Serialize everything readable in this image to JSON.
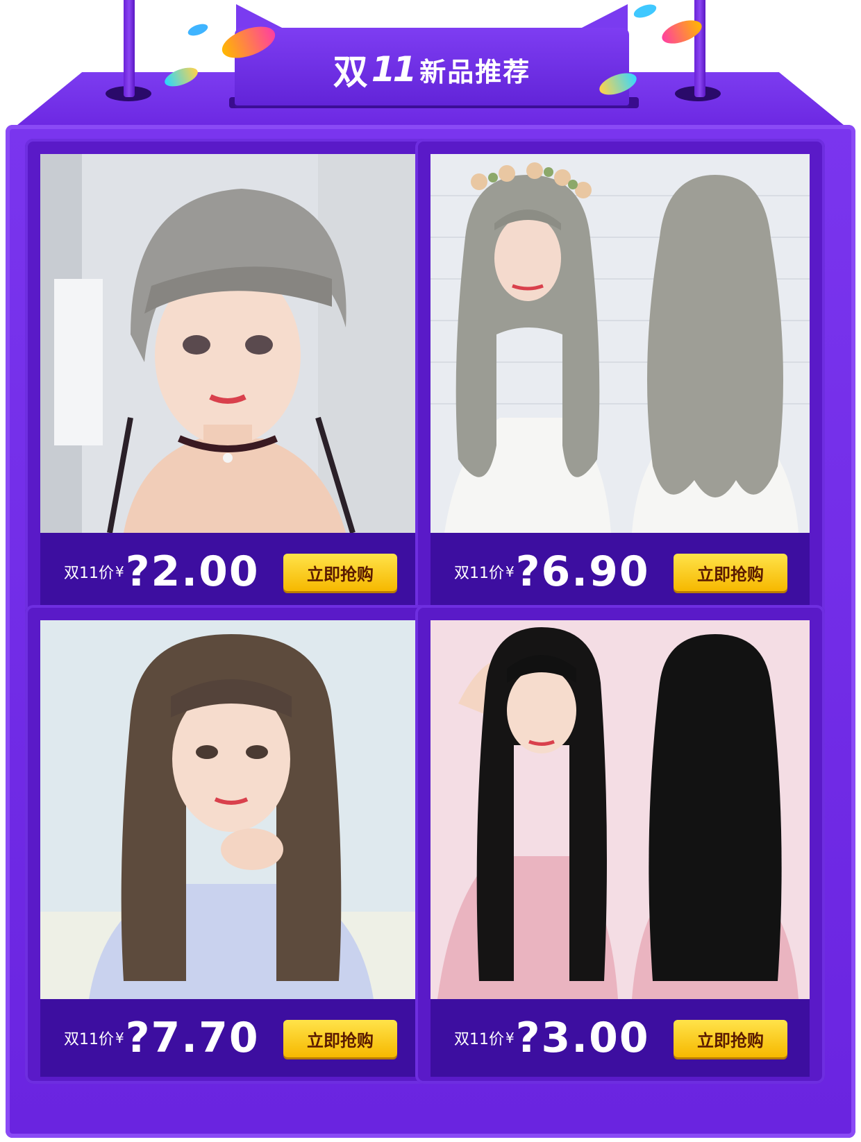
{
  "header": {
    "title_part1": "双",
    "title_part2": "11",
    "title_part3": "新品推荐"
  },
  "colors": {
    "frame_purple": "#6a24e0",
    "bar_purple": "#3d0ea0",
    "button_yellow": "#ffd21e",
    "button_text": "#5a1a00"
  },
  "products": [
    {
      "image_icon": "short-ash-wig-photo",
      "price_label": "双11价",
      "currency": "¥",
      "price": "?2.00",
      "button_label": "立即抢购"
    },
    {
      "image_icon": "long-wavy-ash-wig-photo",
      "price_label": "双11价",
      "currency": "¥",
      "price": "?6.90",
      "button_label": "立即抢购"
    },
    {
      "image_icon": "long-brown-straight-wig-photo",
      "price_label": "双11价",
      "currency": "¥",
      "price": "?7.70",
      "button_label": "立即抢购"
    },
    {
      "image_icon": "long-black-straight-wig-photo",
      "price_label": "双11价",
      "currency": "¥",
      "price": "?3.00",
      "button_label": "立即抢购"
    }
  ]
}
